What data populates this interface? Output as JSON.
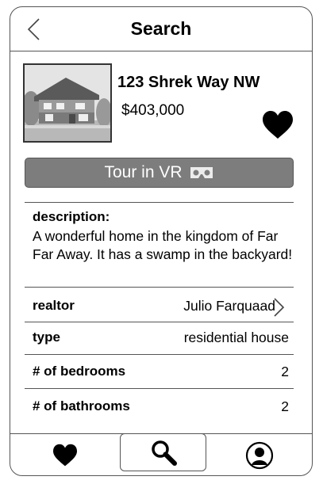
{
  "header": {
    "title": "Search",
    "back_icon": "chevron-left-icon"
  },
  "listing": {
    "address": "123 Shrek Way NW",
    "price": "$403,000",
    "favorite_icon": "heart-icon",
    "vr_button": {
      "label": "Tour in VR",
      "icon": "vr-headset-icon"
    }
  },
  "description": {
    "label": "description:",
    "text": "A wonderful home in the kingdom of Far Far Away. It has a swamp in the backyard!"
  },
  "details": [
    {
      "label": "realtor",
      "value": "Julio Farquaad",
      "icon": "chevron-right-icon"
    },
    {
      "label": "type",
      "value": "residential house"
    },
    {
      "label": "# of bedrooms",
      "value": "2"
    },
    {
      "label": "# of bathrooms",
      "value": "2"
    }
  ],
  "tabbar": {
    "tabs": [
      {
        "name": "favorites",
        "icon": "heart-icon"
      },
      {
        "name": "search",
        "icon": "search-icon",
        "active": true
      },
      {
        "name": "profile",
        "icon": "user-icon"
      }
    ]
  }
}
